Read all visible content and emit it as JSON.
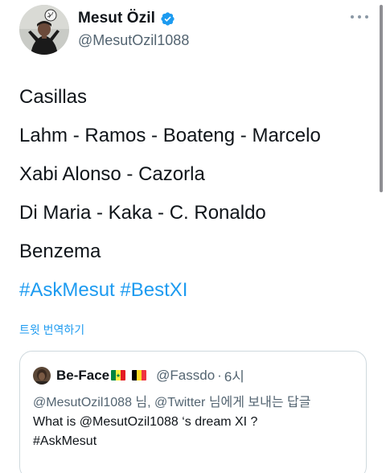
{
  "author": {
    "display_name": "Mesut Özil",
    "handle": "@MesutOzil1088",
    "verified": true,
    "avatar_icon": "profile-photo"
  },
  "tweet": {
    "lines": [
      "Casillas",
      "Lahm - Ramos - Boateng - Marcelo",
      "Xabi Alonso - Cazorla",
      "Di Maria - Kaka - C. Ronaldo",
      "Benzema"
    ],
    "hashtags": "#AskMesut #BestXI",
    "translate_label": "트윗 번역하기"
  },
  "quoted_tweet": {
    "display_name": "Be-Face",
    "flags": [
      "senegal-flag",
      "belgium-flag"
    ],
    "handle": "@Fassdo",
    "separator": "·",
    "time": "6시",
    "reply_context": "@MesutOzil1088 님, @Twitter 님에게 보내는 답글",
    "text_lines": [
      "What is @MesutOzil1088 ‘s dream XI ?",
      "#AskMesut"
    ]
  },
  "colors": {
    "link_blue": "#1d9bf0",
    "secondary_text": "#536471",
    "verified_blue": "#1d9bf0",
    "border": "#cfd9de"
  }
}
